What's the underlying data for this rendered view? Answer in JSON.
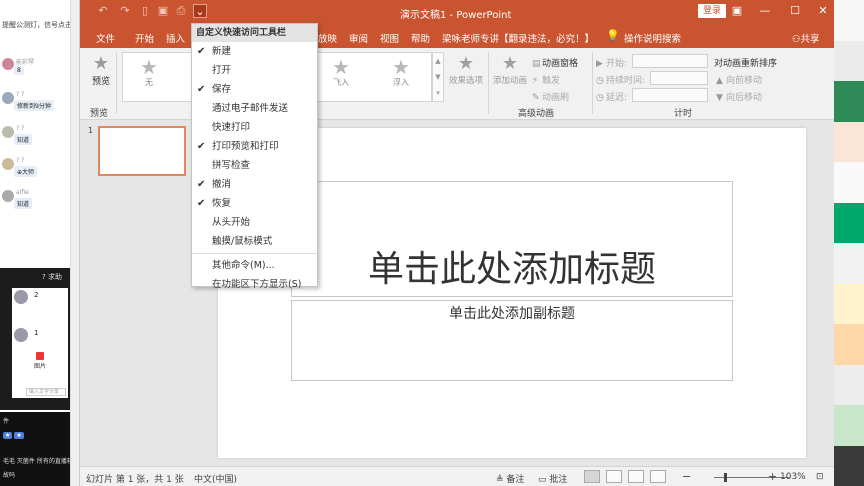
{
  "chat": {
    "notice": "提醒公测灯，信号点击西来源",
    "messages": [
      {
        "name": "能彩琴",
        "bubble": "8"
      },
      {
        "name": "? ?",
        "bubble": "修新到9分钟"
      },
      {
        "name": "? ?",
        "bubble": "知道"
      },
      {
        "name": "? ?",
        "bubble": "⊕大师"
      },
      {
        "name": "alfie",
        "bubble": "知道"
      }
    ],
    "help": "? 求助",
    "participants": [
      "2",
      "1"
    ],
    "picture_label": "图片",
    "input_placeholder": "输入文字分享",
    "lower_lines": [
      "件",
      "毛毛 灭菌件 所有的直播软",
      "故吗"
    ]
  },
  "titlebar": {
    "title": "演示文稿1 - PowerPoint",
    "login": "登录",
    "qat_icons": [
      "undo-icon",
      "redo-icon",
      "new-icon",
      "save-icon",
      "print-preview-icon",
      "customize-qat-icon"
    ]
  },
  "tabs": [
    "文件",
    "开始",
    "插入",
    "放映",
    "审阅",
    "视图",
    "帮助",
    "梁咏老师专讲【翻录违法，必究！】"
  ],
  "tellme": "操作说明搜索",
  "share": "共享",
  "ribbon": {
    "preview": "预览",
    "preview_group": "预览",
    "gallery": [
      "无",
      "飞入",
      "浮入"
    ],
    "effect_options": "效果选项",
    "add_animation": "添加动画",
    "animation_pane": "动画窗格",
    "trigger": "触发",
    "animation_painter": "动画刷",
    "advanced_group": "高级动画",
    "start": "开始:",
    "duration": "持续时间:",
    "delay": "延迟:",
    "reorder": "对动画重新排序",
    "move_earlier": "向前移动",
    "move_later": "向后移动",
    "timing_group": "计时"
  },
  "thumbnail": {
    "number": "1"
  },
  "slide": {
    "title_placeholder": "单击此处添加标题",
    "subtitle_placeholder": "单击此处添加副标题"
  },
  "status": {
    "slide_info": "幻灯片 第 1 张，共 1 张",
    "language": "中文(中国)",
    "notes": "备注",
    "comments": "批注",
    "zoom": "103%"
  },
  "qat_menu": {
    "header": "自定义快速访问工具栏",
    "items": [
      {
        "label": "新建",
        "checked": true
      },
      {
        "label": "打开",
        "checked": false
      },
      {
        "label": "保存",
        "checked": true
      },
      {
        "label": "通过电子邮件发送",
        "checked": false
      },
      {
        "label": "快速打印",
        "checked": false
      },
      {
        "label": "打印预览和打印",
        "checked": true
      },
      {
        "label": "拼写检查",
        "checked": false
      },
      {
        "label": "撤消",
        "checked": true
      },
      {
        "label": "恢复",
        "checked": true
      },
      {
        "label": "从头开始",
        "checked": false
      },
      {
        "label": "触摸/鼠标模式",
        "checked": false
      }
    ],
    "more_commands": "其他命令(M)...",
    "show_below": "在功能区下方显示(S)"
  },
  "colors": {
    "accent": "#c9542f",
    "selection_border": "#e4865d",
    "strip": [
      "#f6f6f6",
      "#eaeaea",
      "#2e8b57",
      "#fbe5d6",
      "#f9f9f9",
      "#00a86b",
      "#f2f2f2",
      "#fff2cc",
      "#ffd7a8",
      "#ededed",
      "#c8e6c9",
      "#3a3a3a"
    ]
  }
}
